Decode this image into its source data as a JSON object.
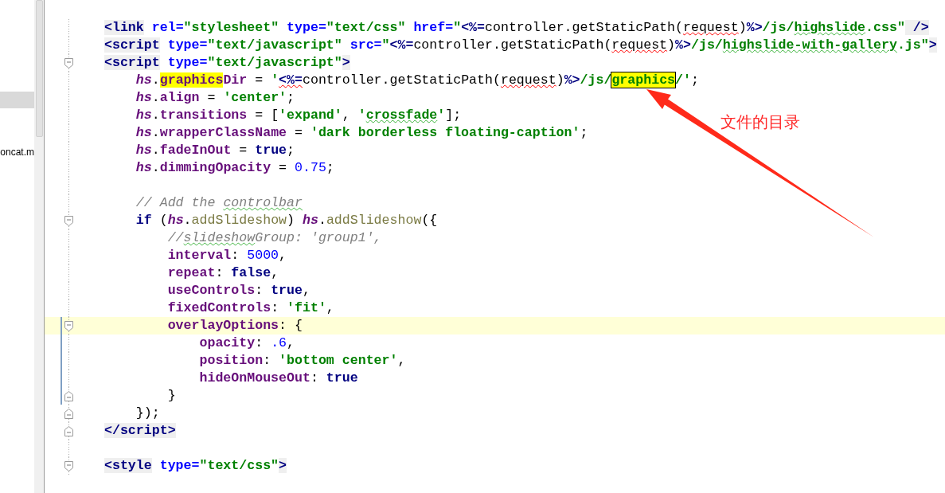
{
  "sidebar": {
    "items": [
      {
        "selected": true
      },
      {
        "label": "oncat.m",
        "selected": false
      }
    ]
  },
  "editor": {
    "lines": [
      {
        "fold_start": false,
        "fold_end": false,
        "current": false,
        "tokens": [
          {
            "kind": "tag",
            "text": "<link"
          },
          {
            "kind": "attr",
            "text": " rel="
          },
          {
            "kind": "str",
            "text": "\"stylesheet\""
          },
          {
            "kind": "attr",
            "text": " type="
          },
          {
            "kind": "str",
            "text": "\"text/css\""
          },
          {
            "kind": "attr",
            "text": " href="
          },
          {
            "kind": "str",
            "text": "\""
          },
          {
            "kind": "jsp",
            "text": "<%="
          },
          {
            "kind": "plain",
            "text": "controller.getStaticPath("
          },
          {
            "kind": "plain",
            "text": "request",
            "error": true
          },
          {
            "kind": "plain",
            "text": ")"
          },
          {
            "kind": "jsp",
            "text": "%>"
          },
          {
            "kind": "str",
            "text": "/js/"
          },
          {
            "kind": "str",
            "text": "highslide",
            "typo": true
          },
          {
            "kind": "str",
            "text": ".css\""
          },
          {
            "kind": "tag",
            "text": " />"
          }
        ]
      },
      {
        "fold_start": false,
        "fold_end": false,
        "current": false,
        "tokens": [
          {
            "kind": "tag",
            "text": "<script"
          },
          {
            "kind": "attr",
            "text": " type="
          },
          {
            "kind": "str",
            "text": "\"text/javascript\""
          },
          {
            "kind": "attr",
            "text": " src="
          },
          {
            "kind": "str",
            "text": "\""
          },
          {
            "kind": "jsp",
            "text": "<%="
          },
          {
            "kind": "plain",
            "text": "controller.getStaticPath("
          },
          {
            "kind": "plain",
            "text": "request",
            "error": true
          },
          {
            "kind": "plain",
            "text": ")"
          },
          {
            "kind": "jsp",
            "text": "%>"
          },
          {
            "kind": "str",
            "text": "/js/"
          },
          {
            "kind": "str",
            "text": "highslide-with-gallery",
            "typo": true
          },
          {
            "kind": "str",
            "text": ".js\""
          },
          {
            "kind": "tag",
            "text": ">"
          }
        ]
      },
      {
        "fold_start": true,
        "fold_end": false,
        "current": false,
        "tokens": [
          {
            "kind": "tag",
            "text": "<script"
          },
          {
            "kind": "attr",
            "text": " type="
          },
          {
            "kind": "str",
            "text": "\"text/javascript\""
          },
          {
            "kind": "tag",
            "text": ">"
          }
        ]
      },
      {
        "fold_start": false,
        "fold_end": false,
        "current": false,
        "tokens": [
          {
            "kind": "obj",
            "text": "    hs"
          },
          {
            "kind": "plain",
            "text": "."
          },
          {
            "kind": "prop",
            "text": "graphics",
            "match": true
          },
          {
            "kind": "prop",
            "text": "Dir"
          },
          {
            "kind": "plain",
            "text": " = "
          },
          {
            "kind": "str",
            "text": "'"
          },
          {
            "kind": "jsp",
            "text": "<%=",
            "error": true
          },
          {
            "kind": "plain",
            "text": "controller.getStaticPath("
          },
          {
            "kind": "plain",
            "text": "request",
            "error": true
          },
          {
            "kind": "plain",
            "text": ")"
          },
          {
            "kind": "jsp",
            "text": "%>"
          },
          {
            "kind": "str",
            "text": "/js/"
          },
          {
            "kind": "str",
            "text": "graphics",
            "match": true,
            "current_match": true
          },
          {
            "kind": "str",
            "text": "/'"
          },
          {
            "kind": "plain",
            "text": ";"
          }
        ]
      },
      {
        "fold_start": false,
        "fold_end": false,
        "current": false,
        "tokens": [
          {
            "kind": "obj",
            "text": "    hs"
          },
          {
            "kind": "plain",
            "text": "."
          },
          {
            "kind": "prop",
            "text": "align"
          },
          {
            "kind": "plain",
            "text": " = "
          },
          {
            "kind": "str",
            "text": "'center'"
          },
          {
            "kind": "plain",
            "text": ";"
          }
        ]
      },
      {
        "fold_start": false,
        "fold_end": false,
        "current": false,
        "tokens": [
          {
            "kind": "obj",
            "text": "    hs"
          },
          {
            "kind": "plain",
            "text": "."
          },
          {
            "kind": "prop",
            "text": "transitions"
          },
          {
            "kind": "plain",
            "text": " = ["
          },
          {
            "kind": "str",
            "text": "'expand'"
          },
          {
            "kind": "plain",
            "text": ", "
          },
          {
            "kind": "str",
            "text": "'"
          },
          {
            "kind": "str",
            "text": "crossfade",
            "typo": true
          },
          {
            "kind": "str",
            "text": "'"
          },
          {
            "kind": "plain",
            "text": "];"
          }
        ]
      },
      {
        "fold_start": false,
        "fold_end": false,
        "current": false,
        "tokens": [
          {
            "kind": "obj",
            "text": "    hs"
          },
          {
            "kind": "plain",
            "text": "."
          },
          {
            "kind": "prop",
            "text": "wrapperClassName"
          },
          {
            "kind": "plain",
            "text": " = "
          },
          {
            "kind": "str",
            "text": "'dark borderless floating-caption'"
          },
          {
            "kind": "plain",
            "text": ";"
          }
        ]
      },
      {
        "fold_start": false,
        "fold_end": false,
        "current": false,
        "tokens": [
          {
            "kind": "obj",
            "text": "    hs"
          },
          {
            "kind": "plain",
            "text": "."
          },
          {
            "kind": "prop",
            "text": "fadeInOut"
          },
          {
            "kind": "plain",
            "text": " = "
          },
          {
            "kind": "keyword",
            "text": "true"
          },
          {
            "kind": "plain",
            "text": ";"
          }
        ]
      },
      {
        "fold_start": false,
        "fold_end": false,
        "current": false,
        "tokens": [
          {
            "kind": "obj",
            "text": "    hs"
          },
          {
            "kind": "plain",
            "text": "."
          },
          {
            "kind": "prop",
            "text": "dimmingOpacity"
          },
          {
            "kind": "plain",
            "text": " = "
          },
          {
            "kind": "num",
            "text": "0.75"
          },
          {
            "kind": "plain",
            "text": ";"
          }
        ]
      },
      {
        "fold_start": false,
        "fold_end": false,
        "current": false
      },
      {
        "fold_start": false,
        "fold_end": false,
        "current": false,
        "tokens": [
          {
            "kind": "comment",
            "text": "    // Add the "
          },
          {
            "kind": "comment",
            "text": "controlbar",
            "typo": true
          }
        ]
      },
      {
        "fold_start": true,
        "fold_end": false,
        "current": false,
        "tokens": [
          {
            "kind": "keyword",
            "text": "    if"
          },
          {
            "kind": "plain",
            "text": " ("
          },
          {
            "kind": "obj",
            "text": "hs"
          },
          {
            "kind": "plain",
            "text": "."
          },
          {
            "kind": "method",
            "text": "addSlideshow"
          },
          {
            "kind": "plain",
            "text": ") "
          },
          {
            "kind": "obj",
            "text": "hs"
          },
          {
            "kind": "plain",
            "text": "."
          },
          {
            "kind": "method",
            "text": "addSlideshow"
          },
          {
            "kind": "plain",
            "text": "({"
          }
        ]
      },
      {
        "fold_start": false,
        "fold_end": false,
        "current": false,
        "tokens": [
          {
            "kind": "comment",
            "text": "        //"
          },
          {
            "kind": "comment",
            "text": "slideshow",
            "typo": true
          },
          {
            "kind": "comment",
            "text": "Group: 'group1',"
          }
        ]
      },
      {
        "fold_start": false,
        "fold_end": false,
        "current": false,
        "tokens": [
          {
            "kind": "prop",
            "text": "        interval"
          },
          {
            "kind": "plain",
            "text": ": "
          },
          {
            "kind": "num",
            "text": "5000"
          },
          {
            "kind": "plain",
            "text": ","
          }
        ]
      },
      {
        "fold_start": false,
        "fold_end": false,
        "current": false,
        "tokens": [
          {
            "kind": "prop",
            "text": "        repeat"
          },
          {
            "kind": "plain",
            "text": ": "
          },
          {
            "kind": "keyword",
            "text": "false"
          },
          {
            "kind": "plain",
            "text": ","
          }
        ]
      },
      {
        "fold_start": false,
        "fold_end": false,
        "current": false,
        "tokens": [
          {
            "kind": "prop",
            "text": "        useControls"
          },
          {
            "kind": "plain",
            "text": ": "
          },
          {
            "kind": "keyword",
            "text": "true"
          },
          {
            "kind": "plain",
            "text": ","
          }
        ]
      },
      {
        "fold_start": false,
        "fold_end": false,
        "current": false,
        "tokens": [
          {
            "kind": "prop",
            "text": "        fixedControls"
          },
          {
            "kind": "plain",
            "text": ": "
          },
          {
            "kind": "str",
            "text": "'fit'"
          },
          {
            "kind": "plain",
            "text": ","
          }
        ]
      },
      {
        "fold_start": true,
        "fold_end": false,
        "current": true,
        "tokens": [
          {
            "kind": "prop",
            "text": "        overlayOptions"
          },
          {
            "kind": "plain",
            "text": ": {"
          }
        ]
      },
      {
        "fold_start": false,
        "fold_end": false,
        "current": false,
        "tokens": [
          {
            "kind": "prop",
            "text": "            opacity"
          },
          {
            "kind": "plain",
            "text": ": "
          },
          {
            "kind": "num",
            "text": ".6"
          },
          {
            "kind": "plain",
            "text": ","
          }
        ]
      },
      {
        "fold_start": false,
        "fold_end": false,
        "current": false,
        "tokens": [
          {
            "kind": "prop",
            "text": "            position"
          },
          {
            "kind": "plain",
            "text": ": "
          },
          {
            "kind": "str",
            "text": "'bottom center'"
          },
          {
            "kind": "plain",
            "text": ","
          }
        ]
      },
      {
        "fold_start": false,
        "fold_end": false,
        "current": false,
        "tokens": [
          {
            "kind": "prop",
            "text": "            hideOnMouseOut"
          },
          {
            "kind": "plain",
            "text": ": "
          },
          {
            "kind": "keyword",
            "text": "true"
          }
        ]
      },
      {
        "fold_start": false,
        "fold_end": true,
        "current": false,
        "tokens": [
          {
            "kind": "plain",
            "text": "        }"
          }
        ]
      },
      {
        "fold_start": false,
        "fold_end": true,
        "current": false,
        "tokens": [
          {
            "kind": "plain",
            "text": "    });"
          }
        ]
      },
      {
        "fold_start": false,
        "fold_end": true,
        "current": false,
        "tokens": [
          {
            "kind": "tag",
            "text": "</script>"
          }
        ]
      },
      {
        "fold_start": false,
        "fold_end": false,
        "current": false
      },
      {
        "fold_start": true,
        "fold_end": false,
        "current": false,
        "tokens": [
          {
            "kind": "tag",
            "text": "<style"
          },
          {
            "kind": "attr",
            "text": " type="
          },
          {
            "kind": "str",
            "text": "\"text/css\""
          },
          {
            "kind": "tag",
            "text": ">"
          }
        ]
      }
    ]
  },
  "annotation": {
    "text": "文件的目录"
  }
}
